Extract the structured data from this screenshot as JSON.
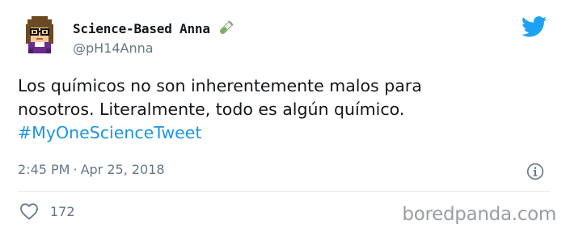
{
  "tweet": {
    "display_name": "Science-Based Anna",
    "handle": "@pH14Anna",
    "text_lines": [
      "Los químicos no son inherentemente malos para",
      "nosotros. Literalmente, todo es algún químico."
    ],
    "hashtag": "#MyOneScienceTweet",
    "time": "2:45 PM",
    "separator": "·",
    "date": "Apr 25, 2018",
    "like_count": "172"
  },
  "icons": {
    "avatar": "pixel-art-avatar",
    "emoji": "test-tube-icon",
    "brand": "twitter-bird-icon",
    "info": "info-icon",
    "like": "heart-icon"
  },
  "colors": {
    "link": "#1b95e0",
    "brand": "#1da1f2",
    "muted": "#657786",
    "text": "#14171a"
  },
  "watermark": "boredpanda.com"
}
